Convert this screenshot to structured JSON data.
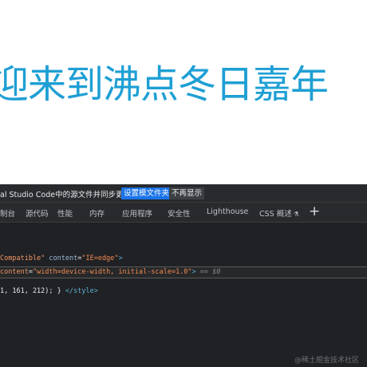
{
  "page": {
    "heading": "迎来到沸点冬日嘉年"
  },
  "devtools": {
    "infobar": {
      "message": "al Studio Code中的源文件并同步更改。",
      "primary_button": "设置模文件夹",
      "secondary_button": "不再显示"
    },
    "tabs": [
      {
        "label": "制台"
      },
      {
        "label": "源代码"
      },
      {
        "label": "性能"
      },
      {
        "label": "内存"
      },
      {
        "label": "应用程序"
      },
      {
        "label": "安全性"
      },
      {
        "label": "Lighthouse"
      },
      {
        "label": "CSS 概述"
      }
    ],
    "tab_pin_icon": "flask-icon",
    "add_tab_icon": "plus-icon",
    "code": {
      "line1": {
        "attr_fragment": "Compatible\"",
        "attr_name": "content",
        "attr_value": "\"IE=edge\"",
        "tag_close": ">"
      },
      "line2": {
        "attr_name": "content",
        "attr_value": "\"width=device-width, initial-scale=1.0\"",
        "tag_close": ">",
        "eq_marker": "== $0"
      },
      "line3": {
        "text": "1, 161, 212); }",
        "tag": "</style>"
      }
    },
    "colors": {
      "heading": "#1e9fd4",
      "primary_button": "#1a73e8",
      "panel_bg": "#202124"
    }
  },
  "watermark": "@稀土掘金技术社区"
}
